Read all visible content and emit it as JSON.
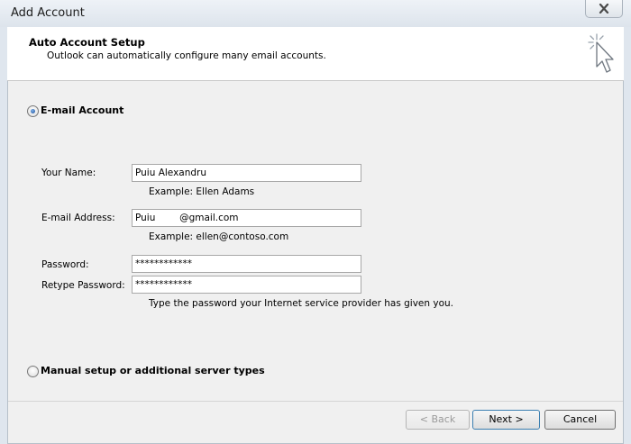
{
  "window": {
    "title": "Add Account",
    "close_icon": "close-icon"
  },
  "header": {
    "title": "Auto Account Setup",
    "subtitle": "Outlook can automatically configure many email accounts.",
    "icon": "wizard-cursor-icon"
  },
  "email_account": {
    "label": "E-mail Account",
    "selected": true
  },
  "form": {
    "name": {
      "label": "Your Name:",
      "value": "Puiu Alexandru",
      "example": "Example: Ellen Adams"
    },
    "email": {
      "label": "E-mail Address:",
      "value": "Puiu        @gmail.com",
      "example": "Example: ellen@contoso.com"
    },
    "password": {
      "label": "Password:",
      "value": "************"
    },
    "retype_password": {
      "label": "Retype Password:",
      "value": "************"
    },
    "password_hint": "Type the password your Internet service provider has given you."
  },
  "manual_setup": {
    "label": "Manual setup or additional server types",
    "selected": false
  },
  "buttons": {
    "back": "< Back",
    "next": "Next >",
    "cancel": "Cancel"
  }
}
